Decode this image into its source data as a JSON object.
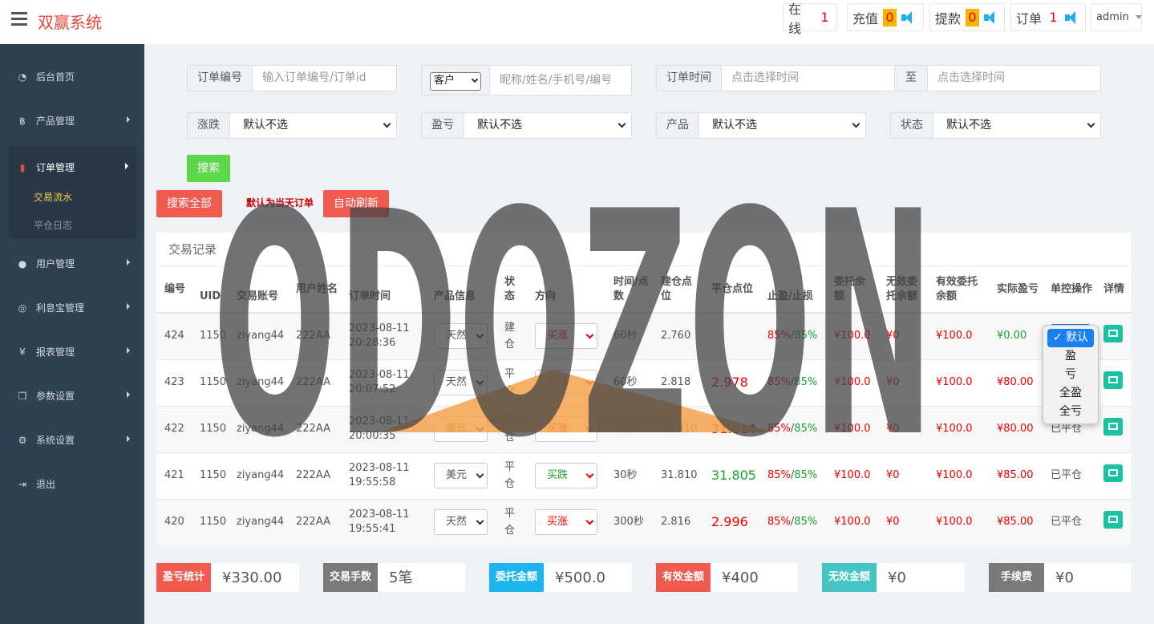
{
  "header": {
    "brand": "双赢系统",
    "stats": [
      {
        "label": "在线",
        "count": "1"
      },
      {
        "label": "充值",
        "count": "0"
      },
      {
        "label": "提款",
        "count": "0"
      },
      {
        "label": "订单",
        "count": "1"
      }
    ],
    "user": "admin"
  },
  "sidebar": {
    "items": [
      {
        "label": "后台首页",
        "icon": "dashboard-icon"
      },
      {
        "label": "产品管理",
        "icon": "bitcoin-icon"
      },
      {
        "label": "订单管理",
        "icon": "order-icon"
      },
      {
        "label": "用户管理",
        "icon": "user-icon"
      },
      {
        "label": "利息宝管理",
        "icon": "interest-icon"
      },
      {
        "label": "报表管理",
        "icon": "yen-icon"
      },
      {
        "label": "参数设置",
        "icon": "copy-icon"
      },
      {
        "label": "系统设置",
        "icon": "cogs-icon"
      },
      {
        "label": "退出",
        "icon": "signout-icon"
      }
    ],
    "submenu": [
      "交易流水",
      "平仓日志"
    ]
  },
  "filters": {
    "order_no_label": "订单编号",
    "order_no_placeholder": "输入订单编号/订单id",
    "customer_select": "客户",
    "customer_placeholder": "昵称/姓名/手机号/编号",
    "time_label": "订单时间",
    "time_placeholder_start": "点击选择时间",
    "to_label": "至",
    "time_placeholder_end": "点击选择时间",
    "rise_fall_label": "涨跌",
    "profit_loss_label": "盈亏",
    "product_label": "产品",
    "status_label": "状态",
    "default_option": "默认不选"
  },
  "buttons": {
    "search": "搜索",
    "search_all": "搜索全部",
    "default_note": "默认为当天订单",
    "auto_refresh": "自动刷新"
  },
  "table": {
    "title": "交易记录",
    "columns": [
      "编号",
      "UID",
      "交易账号",
      "用户姓名",
      "订单时间",
      "产品信息",
      "状态",
      "方向",
      "时间/点数",
      "建仓点位",
      "平仓点位",
      "止盈/止损",
      "委托余额",
      "无效委托余额",
      "有效委托余额",
      "实际盈亏",
      "单控操作",
      "详情"
    ],
    "rows": [
      {
        "id": "424",
        "uid": "1150",
        "account": "ziyang44",
        "name": "222AA",
        "date": "2023-08-11",
        "time": "20:28:36",
        "product": "天然",
        "status": "建仓",
        "direction": "买涨",
        "period": "60秒",
        "open": "2.760",
        "close": "",
        "tp": "85%",
        "sl": "85%",
        "entrust": "¥100.0",
        "invalid": "¥0",
        "valid": "¥100.0",
        "pnl": "¥0.00",
        "control": "",
        "pnl_color": "green",
        "dir_color": "red",
        "close_color": "red"
      },
      {
        "id": "423",
        "uid": "1150",
        "account": "ziyang44",
        "name": "222AA",
        "date": "2023-08-11",
        "time": "20:07:52",
        "product": "天然",
        "status": "平仓",
        "direction": "买涨",
        "period": "60秒",
        "open": "2.818",
        "close": "2.978",
        "tp": "85%",
        "sl": "85%",
        "entrust": "¥100.0",
        "invalid": "¥0",
        "valid": "¥100.0",
        "pnl": "¥80.00",
        "control": "",
        "pnl_color": "red",
        "dir_color": "red",
        "close_color": "red"
      },
      {
        "id": "422",
        "uid": "1150",
        "account": "ziyang44",
        "name": "222AA",
        "date": "2023-08-11",
        "time": "20:00:35",
        "product": "美元",
        "status": "平仓",
        "direction": "买涨",
        "period": "30秒",
        "open": "31.810",
        "close": "31.814",
        "tp": "85%",
        "sl": "85%",
        "entrust": "¥100.0",
        "invalid": "¥0",
        "valid": "¥100.0",
        "pnl": "¥80.00",
        "control": "已平仓",
        "pnl_color": "red",
        "dir_color": "red",
        "close_color": "red"
      },
      {
        "id": "421",
        "uid": "1150",
        "account": "ziyang44",
        "name": "222AA",
        "date": "2023-08-11",
        "time": "19:55:58",
        "product": "美元",
        "status": "平仓",
        "direction": "买跌",
        "period": "30秒",
        "open": "31.810",
        "close": "31.805",
        "tp": "85%",
        "sl": "85%",
        "entrust": "¥100.0",
        "invalid": "¥0",
        "valid": "¥100.0",
        "pnl": "¥85.00",
        "control": "已平仓",
        "pnl_color": "red",
        "dir_color": "green",
        "close_color": "green"
      },
      {
        "id": "420",
        "uid": "1150",
        "account": "ziyang44",
        "name": "222AA",
        "date": "2023-08-11",
        "time": "19:55:41",
        "product": "天然",
        "status": "平仓",
        "direction": "买涨",
        "period": "300秒",
        "open": "2.816",
        "close": "2.996",
        "tp": "85%",
        "sl": "85%",
        "entrust": "¥100.0",
        "invalid": "¥0",
        "valid": "¥100.0",
        "pnl": "¥85.00",
        "control": "已平仓",
        "pnl_color": "red",
        "dir_color": "red",
        "close_color": "red"
      }
    ]
  },
  "control_dropdown": {
    "options": [
      "默认",
      "盈",
      "亏",
      "全盈",
      "全亏"
    ],
    "selected": "默认"
  },
  "summary": [
    {
      "label": "盈亏统计",
      "value": "¥330.00",
      "color": "#f05a4f"
    },
    {
      "label": "交易手数",
      "value": "5笔",
      "color": "#7a7a7a"
    },
    {
      "label": "委托金额",
      "value": "¥500.0",
      "color": "#1eb4f0"
    },
    {
      "label": "有效金额",
      "value": "¥400",
      "color": "#f05a4f"
    },
    {
      "label": "无效金额",
      "value": "¥0",
      "color": "#45c4c4"
    },
    {
      "label": "手续费",
      "value": "¥0",
      "color": "#7a7a7a"
    }
  ],
  "watermark": "ODOZON",
  "colors": {
    "accent_red": "#f05a4f",
    "search_green": "#5cd84a",
    "sidebar": "#2f4050",
    "submenu_active": "#f0c94f"
  }
}
